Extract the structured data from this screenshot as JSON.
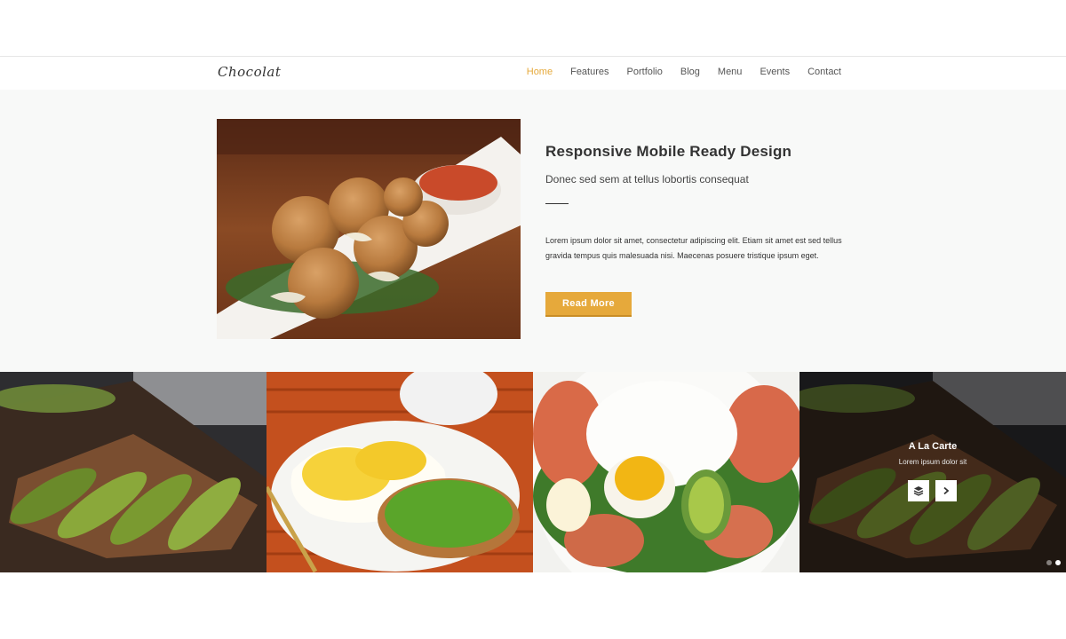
{
  "brand": {
    "logo_text": "Chocolat"
  },
  "nav": {
    "items": [
      {
        "label": "Home",
        "active": true
      },
      {
        "label": "Features"
      },
      {
        "label": "Portfolio"
      },
      {
        "label": "Blog"
      },
      {
        "label": "Menu"
      },
      {
        "label": "Events"
      },
      {
        "label": "Contact"
      }
    ]
  },
  "hero": {
    "title": "Responsive Mobile Ready Design",
    "subtitle": "Donec sed sem at tellus lobortis consequat",
    "body": "Lorem ipsum dolor sit amet, consectetur adipiscing elit. Etiam sit amet est sed tellus gravida tempus quis malesuada nisi. Maecenas posuere tristique ipsum eget.",
    "button_label": "Read More",
    "image_icon": "fried-balls-plate-image"
  },
  "gallery": {
    "tiles": [
      {
        "image_icon": "avocado-toast-image"
      },
      {
        "image_icon": "eggs-and-avocado-plate-image"
      },
      {
        "image_icon": "poached-egg-salmon-salad-image"
      },
      {
        "image_icon": "avocado-toast-image",
        "overlay_title": "A La Carte",
        "overlay_subtitle": "Lorem ipsum dolor sit"
      }
    ],
    "overlay_buttons": {
      "left_icon": "layers-icon",
      "right_icon": "chevron-right-icon"
    },
    "pagination": {
      "count": 2,
      "active": 2
    }
  },
  "colors": {
    "accent": "#e6a93b",
    "hero_bg": "#f8f9f8",
    "text": "#333333"
  }
}
